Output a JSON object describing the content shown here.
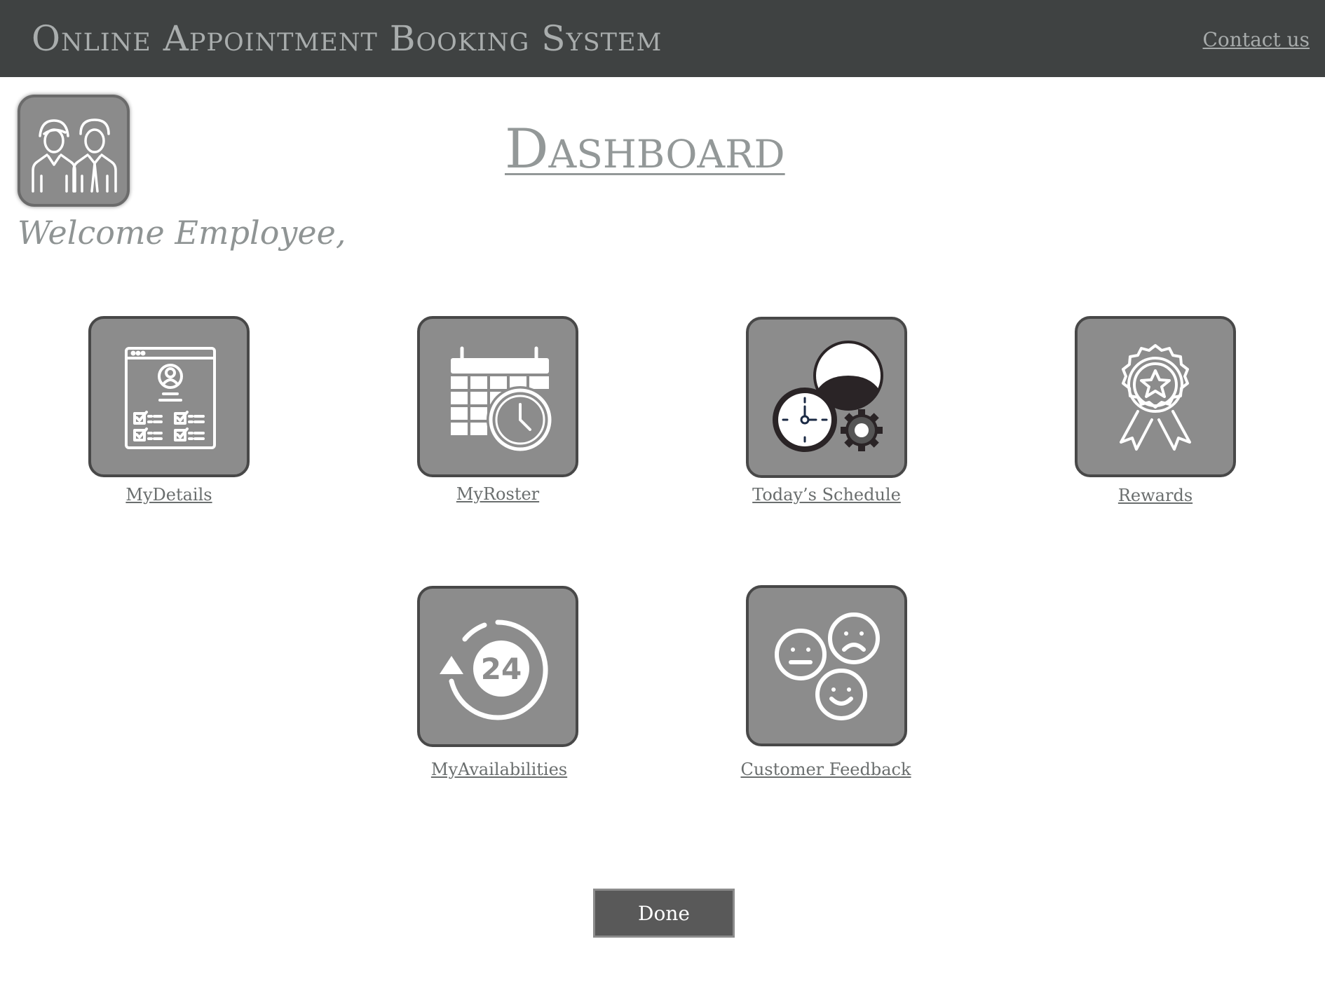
{
  "header": {
    "title": "Online Appointment Booking System",
    "contact_label": "Contact us",
    "bar_color": "#3f4242"
  },
  "user": {
    "avatar_icon": "employees-icon",
    "welcome_text": "Welcome Employee,"
  },
  "page": {
    "title": "Dashboard"
  },
  "tiles": [
    {
      "label": "MyDetails",
      "icon": "profile-checklist-icon"
    },
    {
      "label": "MyRoster",
      "icon": "calendar-clock-icon"
    },
    {
      "label": "Today’s Schedule",
      "icon": "schedule-person-clock-gear-icon"
    },
    {
      "label": "Rewards",
      "icon": "award-ribbon-icon"
    },
    {
      "label": "MyAvailabilities",
      "icon": "24-hours-icon"
    },
    {
      "label": "Customer Feedback",
      "icon": "feedback-faces-icon"
    }
  ],
  "actions": {
    "done_label": "Done"
  },
  "colors": {
    "tile_fill": "#8c8c8c",
    "tile_border": "#484848",
    "button_fill": "#595959"
  }
}
